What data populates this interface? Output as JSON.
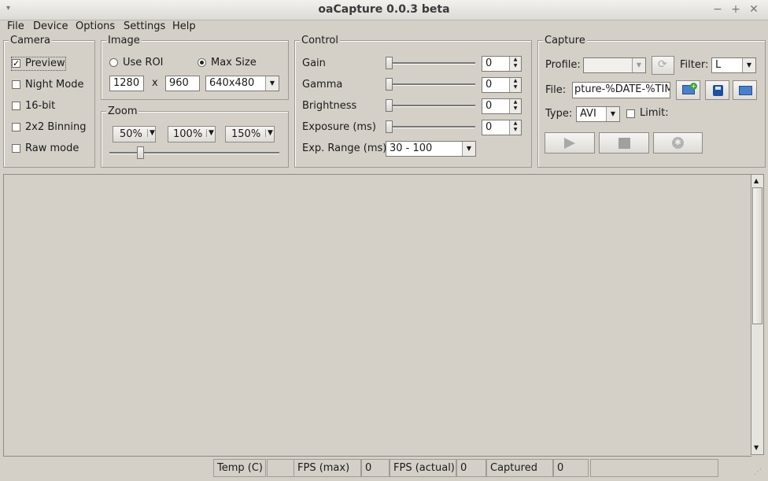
{
  "window": {
    "title": "oaCapture 0.0.3 beta"
  },
  "menu": [
    "File",
    "Device",
    "Options",
    "Settings",
    "Help"
  ],
  "camera": {
    "title": "Camera",
    "options": [
      {
        "label": "Preview",
        "checked": true
      },
      {
        "label": "Night Mode",
        "checked": false
      },
      {
        "label": "16-bit",
        "checked": false
      },
      {
        "label": "2x2 Binning",
        "checked": false
      },
      {
        "label": "Raw mode",
        "checked": false
      }
    ]
  },
  "image": {
    "title": "Image",
    "use_roi": "Use ROI",
    "max_size": "Max Size",
    "width": "1280",
    "x_sep": "x",
    "height": "960",
    "resolution": "640x480"
  },
  "zoom": {
    "title": "Zoom",
    "buttons": [
      "50%",
      "100%",
      "150%"
    ],
    "level": 0.17
  },
  "control": {
    "title": "Control",
    "rows": [
      {
        "label": "Gain",
        "value": "0"
      },
      {
        "label": "Gamma",
        "value": "0"
      },
      {
        "label": "Brightness",
        "value": "0"
      },
      {
        "label": "Exposure (ms)",
        "value": "0"
      }
    ],
    "exp_range_label": "Exp. Range (ms)",
    "exp_range_value": "30 - 100"
  },
  "capture": {
    "title": "Capture",
    "profile_label": "Profile:",
    "profile_value": "",
    "filter_label": "Filter:",
    "filter_value": "L",
    "file_label": "File:",
    "file_value": "pture-%DATE-%TIME",
    "type_label": "Type:",
    "type_value": "AVI",
    "limit_label": "Limit:"
  },
  "status": {
    "temp_label": "Temp (C)",
    "temp_value": "",
    "fps_max_label": "FPS (max)",
    "fps_max_value": "0",
    "fps_actual_label": "FPS (actual)",
    "fps_actual_value": "0",
    "captured_label": "Captured",
    "captured_value": "0"
  },
  "colors": {
    "window_bg": "#d4d0c8",
    "accent_blue": "#2a62b8"
  }
}
